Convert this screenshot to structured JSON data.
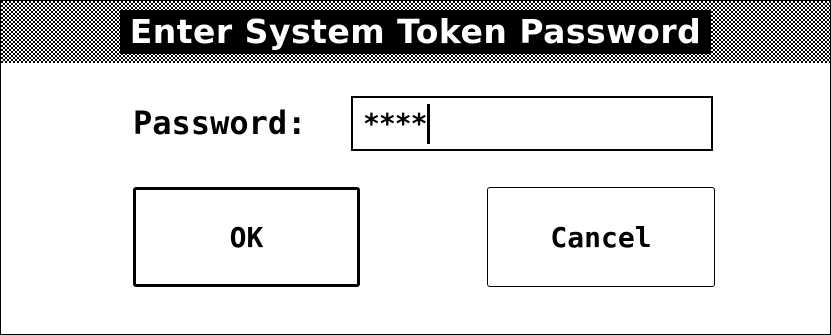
{
  "dialog": {
    "title": "Enter System Token Password",
    "password_label": "Password:",
    "password_value": "****",
    "ok_label": "OK",
    "cancel_label": "Cancel"
  },
  "colors": {
    "foreground": "#000000",
    "background": "#ffffff"
  }
}
